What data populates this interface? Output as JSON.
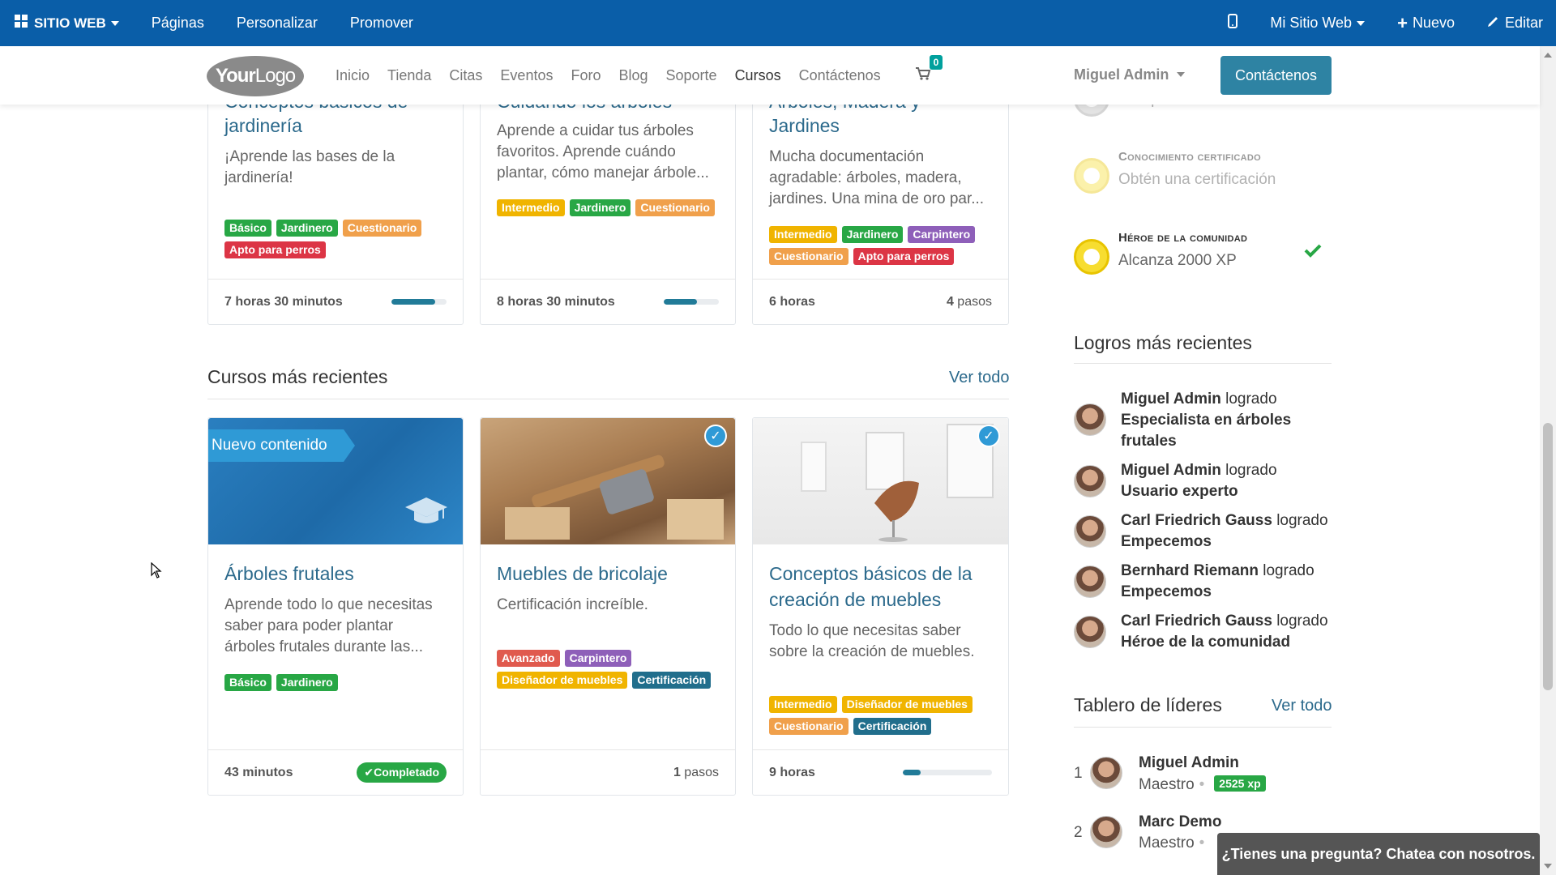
{
  "adminbar": {
    "brand": "SITIO WEB",
    "pages": "Páginas",
    "customize": "Personalizar",
    "promote": "Promover",
    "my_site": "Mi Sitio Web",
    "new": "Nuevo",
    "edit": "Editar",
    "background": "#0a5ea8"
  },
  "navbar": {
    "logo_a": "Your",
    "logo_b": "Logo",
    "links": [
      "Inicio",
      "Tienda",
      "Citas",
      "Eventos",
      "Foro",
      "Blog",
      "Soporte",
      "Cursos",
      "Contáctenos"
    ],
    "active_link": "Cursos",
    "cart_count": "0",
    "user": "Miguel Admin",
    "contact_button": "Contáctenos",
    "contact_color": "#2e83a3"
  },
  "top_courses": [
    {
      "title_top": "Conceptos básicos de",
      "title": "jardinería",
      "desc": "¡Aprende las bases de la jardinería!",
      "tags": [
        "Básico",
        "Jardinero",
        "Cuestionario",
        "Apto para perros"
      ],
      "duration": "7 horas 30 minutos",
      "progress": 0.8
    },
    {
      "title_top": "Cuidando los árboles",
      "title": "",
      "desc": "Aprende a cuidar tus árboles favoritos. Aprende cuándo plantar, cómo manejar árbole...",
      "tags": [
        "Intermedio",
        "Jardinero",
        "Cuestionario"
      ],
      "duration": "8 horas 30 minutos",
      "progress": 0.6
    },
    {
      "title_top": "Árboles, Madera y",
      "title": "Jardines",
      "desc": "Mucha documentación agradable: árboles, madera, jardines. Una mina de oro par...",
      "tags": [
        "Intermedio",
        "Jardinero",
        "Carpintero",
        "Cuestionario",
        "Apto para perros"
      ],
      "duration": "6 horas",
      "steps_num": "4",
      "steps_label": "pasos"
    }
  ],
  "recent": {
    "title": "Cursos más recientes",
    "see_all": "Ver todo",
    "courses": [
      {
        "ribbon": "Nuevo contenido",
        "title_l1": "Árboles frutales",
        "title_l2": "",
        "desc": "Aprende todo lo que necesitas saber para poder plantar árboles frutales durante las...",
        "tags": [
          "Básico",
          "Jardinero"
        ],
        "duration": "43 minutos",
        "status": "Completado"
      },
      {
        "title_l1": "Muebles de bricolaje",
        "title_l2": "",
        "desc": "Certificación increíble.",
        "tags": [
          "Avanzado",
          "Carpintero",
          "Diseñador de muebles",
          "Certificación"
        ],
        "steps_num": "1",
        "steps_label": "pasos"
      },
      {
        "title_l1": "Conceptos básicos de la",
        "title_l2": "creación de muebles",
        "desc": "Todo lo que necesitas saber sobre la creación de muebles.",
        "tags": [
          "Intermedio",
          "Diseñador de muebles",
          "Cuestionario",
          "Certificación"
        ],
        "duration": "9 horas",
        "progress": 0.2
      }
    ]
  },
  "tag_colors": {
    "Básico": "#28a745",
    "Jardinero": "#28a745",
    "Cuestionario": "#f0a04b",
    "Apto para perros": "#dc3545",
    "Intermedio": "#f0b400",
    "Carpintero": "#8e5fb9",
    "Avanzado": "#e05a4e",
    "Diseñador de muebles": "#f0b400",
    "Certificación": "#216e8c"
  },
  "badges": [
    {
      "name": "",
      "desc": "Completa un curso"
    },
    {
      "name": "Conocimiento certificado",
      "desc": "Obtén una certificación"
    },
    {
      "name": "Héroe de la comunidad",
      "desc": "Alcanza 2000 XP",
      "earned": true
    }
  ],
  "achievements": {
    "title": "Logros más recientes",
    "items": [
      {
        "user": "Miguel Admin",
        "verb": "logrado",
        "badge": "Especialista en árboles frutales"
      },
      {
        "user": "Miguel Admin",
        "verb": "logrado",
        "badge": "Usuario experto"
      },
      {
        "user": "Carl Friedrich Gauss",
        "verb": "logrado",
        "badge": "Empecemos"
      },
      {
        "user": "Bernhard Riemann",
        "verb": "logrado",
        "badge": "Empecemos"
      },
      {
        "user": "Carl Friedrich Gauss",
        "verb": "logrado",
        "badge": "Héroe de la comunidad"
      }
    ]
  },
  "leaderboard": {
    "title": "Tablero de líderes",
    "see_all": "Ver todo",
    "rows": [
      {
        "rank": "1",
        "name": "Miguel Admin",
        "level": "Maestro",
        "xp": "2525 xp"
      },
      {
        "rank": "2",
        "name": "Marc Demo",
        "level": "Maestro",
        "xp": ""
      }
    ]
  },
  "chat": "¿Tienes una pregunta? Chatea con nosotros."
}
